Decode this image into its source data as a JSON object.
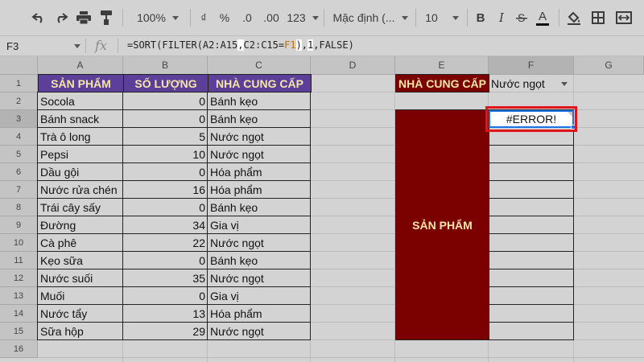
{
  "toolbar": {
    "zoom": "100%",
    "currency": "₫",
    "percent": "%",
    "decrease_decimal": ".0",
    "increase_decimal": ".00",
    "number_format": "123",
    "font": "Mặc định (...",
    "font_size": "10",
    "bold": "B",
    "italic": "I",
    "text_color_letter": "A"
  },
  "formula_bar": {
    "cell_ref": "F3",
    "fx": "fx",
    "formula_part1": "=SORT(FILTER(A2:A15",
    "formula_part2": ",",
    "formula_part3": "C2:C15=",
    "formula_ref": "F1",
    "formula_part4": ")",
    "formula_part5": ",",
    "formula_part6": "1",
    "formula_part7": ",",
    "formula_part8": "FALSE)"
  },
  "columns": [
    "A",
    "B",
    "C",
    "D",
    "E",
    "F",
    "G"
  ],
  "rows": [
    "1",
    "2",
    "3",
    "4",
    "5",
    "6",
    "7",
    "8",
    "9",
    "10",
    "11",
    "12",
    "13",
    "14",
    "15",
    "16"
  ],
  "table": {
    "headers": [
      "SẢN PHẨM",
      "SỐ LƯỢNG",
      "NHÀ CUNG CẤP"
    ],
    "data": [
      [
        "Socola",
        "0",
        "Bánh kẹo"
      ],
      [
        "Bánh snack",
        "0",
        "Bánh kẹo"
      ],
      [
        "Trà ô long",
        "5",
        "Nước ngọt"
      ],
      [
        "Pepsi",
        "10",
        "Nước ngọt"
      ],
      [
        "Dầu gội",
        "0",
        "Hóa phẩm"
      ],
      [
        "Nước rửa chén",
        "16",
        "Hóa phẩm"
      ],
      [
        "Trái cây sấy",
        "0",
        "Bánh kẹo"
      ],
      [
        "Đường",
        "34",
        "Gia vị"
      ],
      [
        "Cà phê",
        "22",
        "Nước ngọt"
      ],
      [
        "Kẹo sữa",
        "0",
        "Bánh kẹo"
      ],
      [
        "Nước suối",
        "35",
        "Nước ngọt"
      ],
      [
        "Muối",
        "0",
        "Gia vị"
      ],
      [
        "Nước tẩy",
        "13",
        "Hóa phẩm"
      ],
      [
        "Sữa hộp",
        "29",
        "Nước ngọt"
      ]
    ]
  },
  "lookup": {
    "supplier_label": "NHÀ CUNG CẤP",
    "supplier_value": "Nước ngọt",
    "product_label": "SẢN PHẨM",
    "result": "#ERROR!"
  },
  "colors": {
    "header_purple": "#5b3f99",
    "header_text": "#f5e6a8",
    "dark_red": "#7b0000",
    "highlight_red": "#e0141b",
    "selection_blue": "#1a73e8"
  }
}
